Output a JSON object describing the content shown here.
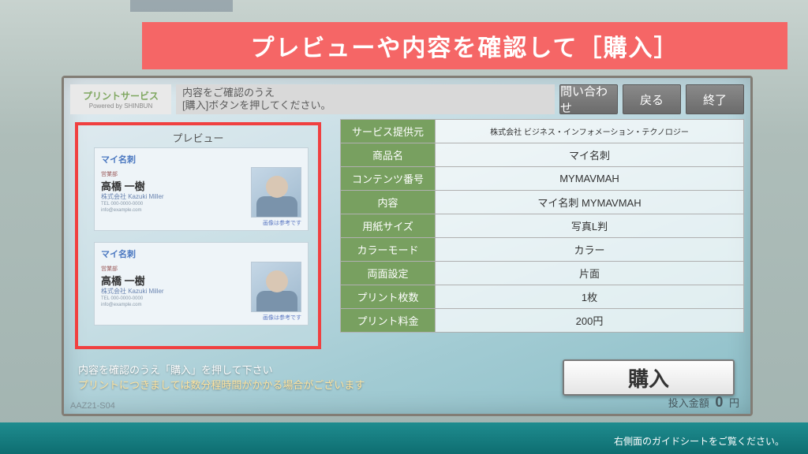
{
  "annotation_banner": "プレビューや内容を確認して［購入］",
  "logo": {
    "line1": "プリントサービス",
    "line2": "Powered by  SHINBUN"
  },
  "instruction": {
    "line1": "内容をご確認のうえ",
    "line2": "[購入]ボタンを押してください。"
  },
  "header_buttons": {
    "inquiry": "問い合わせ",
    "back": "戻る",
    "exit": "終了"
  },
  "preview": {
    "title": "プレビュー",
    "card_tag": "営業部",
    "card_title": "マイ名刺",
    "card_name": "高橋 一樹",
    "card_eng": "株式会社 Kazuki Miller",
    "card_caption": "画像は参考です"
  },
  "details": {
    "rows": [
      {
        "k": "サービス提供元",
        "v": "株式会社 ビジネス・インフォメーション・テクノロジー"
      },
      {
        "k": "商品名",
        "v": "マイ名刺"
      },
      {
        "k": "コンテンツ番号",
        "v": "MYMAVMAH"
      },
      {
        "k": "内容",
        "v": "マイ名刺 MYMAVMAH"
      },
      {
        "k": "用紙サイズ",
        "v": "写真L判"
      },
      {
        "k": "カラーモード",
        "v": "カラー"
      },
      {
        "k": "両面設定",
        "v": "片面"
      },
      {
        "k": "プリント枚数",
        "v": "1枚"
      },
      {
        "k": "プリント料金",
        "v": "200円"
      }
    ]
  },
  "footer": {
    "line1": "内容を確認のうえ「購入」を押して下さい",
    "line2": "プリントにつきましては数分程時間がかかる場合がございます",
    "buy": "購入"
  },
  "model_no": "AAZ21-S04",
  "amount": {
    "label": "投入金額",
    "value": "0",
    "unit": "円"
  },
  "phys_label": "右側面のガイドシートをご覧ください。"
}
